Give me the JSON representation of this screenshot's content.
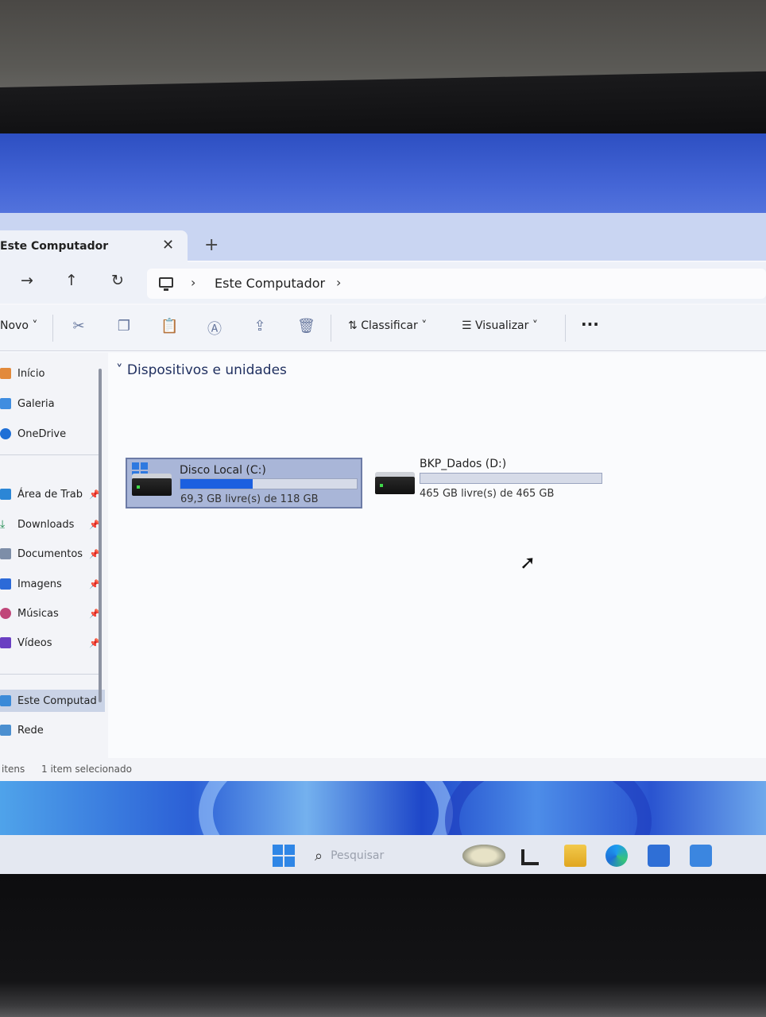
{
  "window": {
    "tab_title": "Este Computador",
    "tab_close": "✕",
    "tab_add": "+"
  },
  "address": {
    "crumb": "Este Computador"
  },
  "toolbar": {
    "new_label": "Novo",
    "sort_label": "Classificar",
    "view_label": "Visualizar",
    "more_label": "···"
  },
  "sidebar": {
    "items": [
      {
        "label": "Início"
      },
      {
        "label": "Galeria"
      },
      {
        "label": "OneDrive"
      },
      {
        "label": "Área de Trab"
      },
      {
        "label": "Downloads"
      },
      {
        "label": "Documentos"
      },
      {
        "label": "Imagens"
      },
      {
        "label": "Músicas"
      },
      {
        "label": "Vídeos"
      },
      {
        "label": "Este Computad"
      },
      {
        "label": "Rede"
      }
    ]
  },
  "content": {
    "section_title": "Dispositivos e unidades",
    "drives": [
      {
        "name": "Disco Local (C:)",
        "free_text": "69,3 GB livre(s) de 118 GB",
        "used_fraction": 0.41
      },
      {
        "name": "BKP_Dados (D:)",
        "free_text": "465 GB livre(s) de 465 GB",
        "used_fraction": 0.0
      }
    ]
  },
  "status": {
    "items": "itens",
    "selected": "1 item selecionado"
  },
  "taskbar": {
    "search_placeholder": "Pesquisar"
  },
  "colors": {
    "accent": "#1b5fe0",
    "selection": "#a9b6d8"
  }
}
